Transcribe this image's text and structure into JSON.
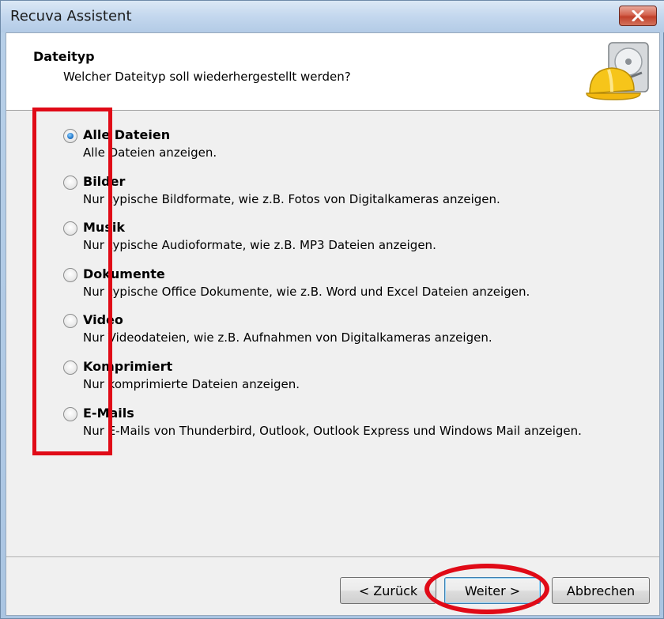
{
  "window": {
    "title": "Recuva Assistent"
  },
  "header": {
    "title": "Dateityp",
    "subtitle": "Welcher Dateityp soll wiederhergestellt werden?",
    "logo_icon": "recuva-hardhat-disk-icon"
  },
  "options": [
    {
      "label": "Alle Dateien",
      "description": "Alle Dateien anzeigen.",
      "checked": true
    },
    {
      "label": "Bilder",
      "description": "Nur typische Bildformate, wie z.B. Fotos von Digitalkameras anzeigen.",
      "checked": false
    },
    {
      "label": "Musik",
      "description": "Nur typische Audioformate, wie z.B. MP3 Dateien anzeigen.",
      "checked": false
    },
    {
      "label": "Dokumente",
      "description": "Nur typische Office Dokumente, wie z.B. Word und Excel Dateien anzeigen.",
      "checked": false
    },
    {
      "label": "Video",
      "description": "Nur Videodateien, wie z.B. Aufnahmen von Digitalkameras anzeigen.",
      "checked": false
    },
    {
      "label": "Komprimiert",
      "description": "Nur komprimierte Dateien anzeigen.",
      "checked": false
    },
    {
      "label": "E-Mails",
      "description": "Nur E-Mails von Thunderbird, Outlook, Outlook Express und Windows Mail anzeigen.",
      "checked": false
    }
  ],
  "buttons": {
    "back": "< Zurück",
    "next": "Weiter >",
    "cancel": "Abbrechen"
  },
  "colors": {
    "annotation": "#e00a17",
    "radio_selected": "#2a7fd0"
  }
}
